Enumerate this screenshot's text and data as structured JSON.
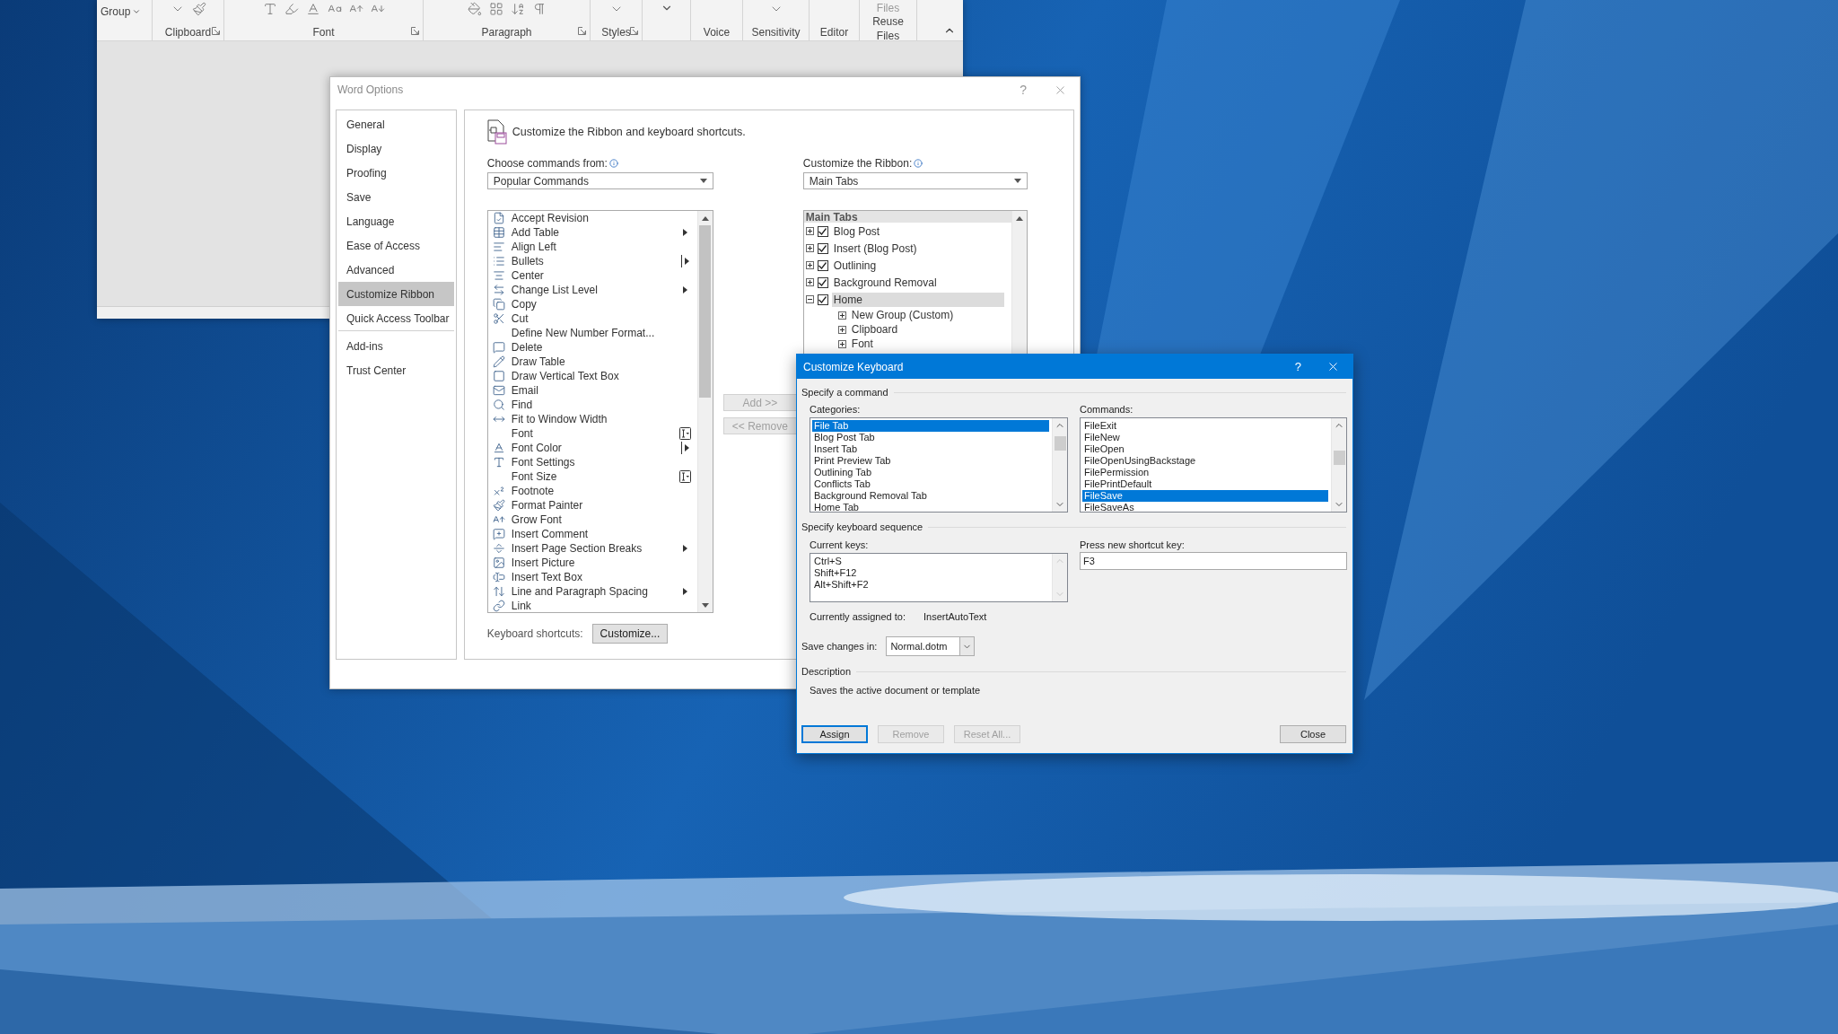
{
  "word_window": {
    "ribbon": {
      "group_button": "Group",
      "groups": [
        {
          "label": "Clipboard",
          "launcher": true
        },
        {
          "label": "Font",
          "launcher": true
        },
        {
          "label": "Paragraph",
          "launcher": true
        },
        {
          "label": "Styles",
          "launcher": true
        },
        {
          "label": "Voice",
          "launcher": false
        },
        {
          "label": "Sensitivity",
          "launcher": false
        },
        {
          "label": "Editor",
          "launcher": false
        },
        {
          "label": "Reuse Files",
          "launcher": false,
          "top_text": "Files"
        }
      ]
    }
  },
  "word_options": {
    "title": "Word Options",
    "help_glyph": "?",
    "nav": [
      {
        "label": "General",
        "selected": false,
        "separator_before": false
      },
      {
        "label": "Display",
        "selected": false,
        "separator_before": false
      },
      {
        "label": "Proofing",
        "selected": false,
        "separator_before": false
      },
      {
        "label": "Save",
        "selected": false,
        "separator_before": false
      },
      {
        "label": "Language",
        "selected": false,
        "separator_before": false
      },
      {
        "label": "Ease of Access",
        "selected": false,
        "separator_before": false
      },
      {
        "label": "Advanced",
        "selected": false,
        "separator_before": false
      },
      {
        "label": "Customize Ribbon",
        "selected": true,
        "separator_before": false
      },
      {
        "label": "Quick Access Toolbar",
        "selected": false,
        "separator_before": false
      },
      {
        "label": "Add-ins",
        "selected": false,
        "separator_before": true
      },
      {
        "label": "Trust Center",
        "selected": false,
        "separator_before": false
      }
    ],
    "heading": "Customize the Ribbon and keyboard shortcuts.",
    "commands_from": {
      "label": "Choose commands from:",
      "value": "Popular Commands"
    },
    "commands": [
      {
        "label": "Accept Revision",
        "has_icon": true,
        "kind": "plain"
      },
      {
        "label": "Add Table",
        "has_icon": true,
        "kind": "submenu"
      },
      {
        "label": "Align Left",
        "has_icon": true,
        "kind": "plain"
      },
      {
        "label": "Bullets",
        "has_icon": true,
        "kind": "split"
      },
      {
        "label": "Center",
        "has_icon": true,
        "kind": "plain"
      },
      {
        "label": "Change List Level",
        "has_icon": true,
        "kind": "submenu"
      },
      {
        "label": "Copy",
        "has_icon": true,
        "kind": "plain"
      },
      {
        "label": "Cut",
        "has_icon": true,
        "kind": "plain"
      },
      {
        "label": "Define New Number Format...",
        "has_icon": false,
        "kind": "plain"
      },
      {
        "label": "Delete",
        "has_icon": true,
        "kind": "plain"
      },
      {
        "label": "Draw Table",
        "has_icon": true,
        "kind": "plain"
      },
      {
        "label": "Draw Vertical Text Box",
        "has_icon": true,
        "kind": "plain"
      },
      {
        "label": "Email",
        "has_icon": true,
        "kind": "plain"
      },
      {
        "label": "Find",
        "has_icon": true,
        "kind": "plain"
      },
      {
        "label": "Fit to Window Width",
        "has_icon": true,
        "kind": "plain"
      },
      {
        "label": "Font",
        "has_icon": false,
        "kind": "combo"
      },
      {
        "label": "Font Color",
        "has_icon": true,
        "kind": "split"
      },
      {
        "label": "Font Settings",
        "has_icon": true,
        "kind": "plain"
      },
      {
        "label": "Font Size",
        "has_icon": false,
        "kind": "combo"
      },
      {
        "label": "Footnote",
        "has_icon": true,
        "kind": "plain"
      },
      {
        "label": "Format Painter",
        "has_icon": true,
        "kind": "plain"
      },
      {
        "label": "Grow Font",
        "has_icon": true,
        "kind": "plain"
      },
      {
        "label": "Insert Comment",
        "has_icon": true,
        "kind": "plain"
      },
      {
        "label": "Insert Page  Section Breaks",
        "has_icon": true,
        "kind": "submenu"
      },
      {
        "label": "Insert Picture",
        "has_icon": true,
        "kind": "plain"
      },
      {
        "label": "Insert Text Box",
        "has_icon": true,
        "kind": "plain"
      },
      {
        "label": "Line and Paragraph Spacing",
        "has_icon": true,
        "kind": "submenu"
      },
      {
        "label": "Link",
        "has_icon": true,
        "kind": "plain"
      }
    ],
    "add_button": {
      "label": "Add >>",
      "disabled": true
    },
    "remove_button": {
      "label": "<< Remove",
      "disabled": true
    },
    "shortcuts_label": "Keyboard shortcuts:",
    "customize_button": "Customize...",
    "ribbon_from": {
      "label": "Customize the Ribbon:",
      "value": "Main Tabs"
    },
    "tree": {
      "header": "Main Tabs",
      "items": [
        {
          "label": "Blog Post",
          "checked": true,
          "expanded": false,
          "selected": false
        },
        {
          "label": "Insert (Blog Post)",
          "checked": true,
          "expanded": false,
          "selected": false
        },
        {
          "label": "Outlining",
          "checked": true,
          "expanded": false,
          "selected": false
        },
        {
          "label": "Background Removal",
          "checked": true,
          "expanded": false,
          "selected": false
        },
        {
          "label": "Home",
          "checked": true,
          "expanded": true,
          "selected": true,
          "children": [
            {
              "label": "New Group (Custom)",
              "expanded": false
            },
            {
              "label": "Clipboard",
              "expanded": false
            },
            {
              "label": "Font",
              "expanded": false
            }
          ]
        }
      ]
    }
  },
  "customize_keyboard": {
    "title": "Customize Keyboard",
    "help_glyph": "?",
    "command_section": "Specify a command",
    "categories": {
      "label": "Categories:",
      "items": [
        {
          "label": "File Tab",
          "selected": true
        },
        {
          "label": "Blog Post Tab",
          "selected": false
        },
        {
          "label": "Insert Tab",
          "selected": false
        },
        {
          "label": "Print Preview Tab",
          "selected": false
        },
        {
          "label": "Outlining Tab",
          "selected": false
        },
        {
          "label": "Conflicts Tab",
          "selected": false
        },
        {
          "label": "Background Removal Tab",
          "selected": false
        },
        {
          "label": "Home Tab",
          "selected": false
        }
      ]
    },
    "commands": {
      "label": "Commands:",
      "items": [
        {
          "label": "FileExit",
          "selected": false
        },
        {
          "label": "FileNew",
          "selected": false
        },
        {
          "label": "FileOpen",
          "selected": false
        },
        {
          "label": "FileOpenUsingBackstage",
          "selected": false
        },
        {
          "label": "FilePermission",
          "selected": false
        },
        {
          "label": "FilePrintDefault",
          "selected": false
        },
        {
          "label": "FileSave",
          "selected": true
        },
        {
          "label": "FileSaveAs",
          "selected": false
        }
      ]
    },
    "sequence_section": "Specify keyboard sequence",
    "current_keys": {
      "label": "Current keys:",
      "items": [
        "Ctrl+S",
        "Shift+F12",
        "Alt+Shift+F2"
      ]
    },
    "new_key": {
      "label": "Press new shortcut key:",
      "value": "F3"
    },
    "assigned": {
      "label": "Currently assigned to:",
      "value": "InsertAutoText"
    },
    "save_in": {
      "label": "Save changes in:",
      "value": "Normal.dotm"
    },
    "description_section": "Description",
    "description": "Saves the active document or template",
    "buttons": [
      {
        "label": "Assign",
        "disabled": false,
        "focused": true
      },
      {
        "label": "Remove",
        "disabled": true,
        "focused": false
      },
      {
        "label": "Reset All...",
        "disabled": true,
        "focused": false
      }
    ],
    "close_button": "Close"
  }
}
